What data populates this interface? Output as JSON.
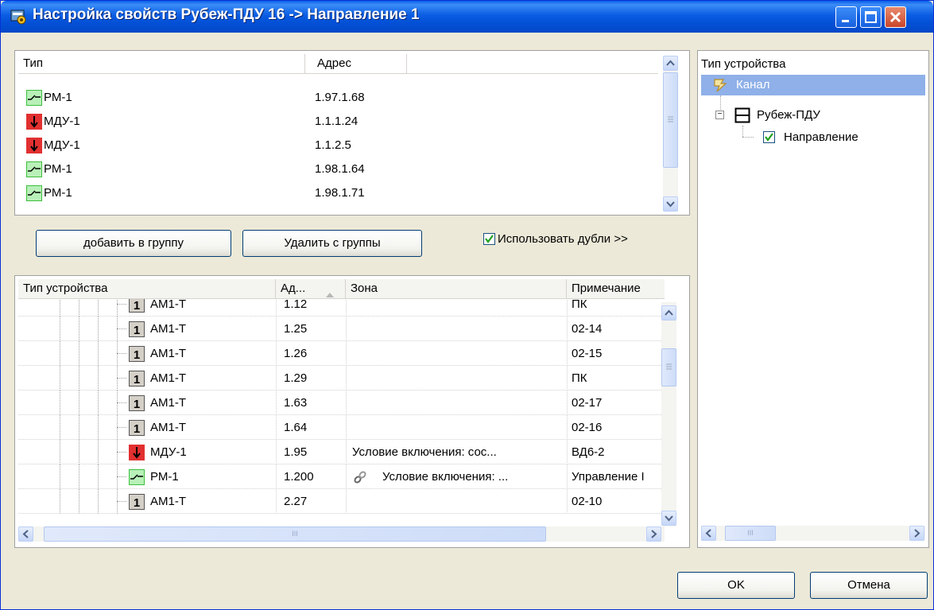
{
  "window": {
    "title": "Настройка свойств Рубеж-ПДУ 16 -> Направление 1"
  },
  "top_table": {
    "headers": {
      "type": "Тип",
      "address": "Адрес"
    },
    "rows": [
      {
        "icon": "relay-icon",
        "type": "РМ-1",
        "address": "1.97.1.68"
      },
      {
        "icon": "mdu-icon",
        "type": "МДУ-1",
        "address": "1.1.1.24"
      },
      {
        "icon": "mdu-icon",
        "type": "МДУ-1",
        "address": "1.1.2.5"
      },
      {
        "icon": "relay-icon",
        "type": "РМ-1",
        "address": "1.98.1.64"
      },
      {
        "icon": "relay-icon",
        "type": "РМ-1",
        "address": "1.98.1.71"
      }
    ]
  },
  "buttons": {
    "add": "добавить в группу",
    "remove": "Удалить с группы",
    "ok": "OK",
    "cancel": "Отмена"
  },
  "use_duplicates": {
    "label": "Использовать дубли >>",
    "checked": true
  },
  "bottom_table": {
    "headers": {
      "device_type": "Тип устройства",
      "address": "Ад...",
      "zone": "Зона",
      "note": "Примечание"
    },
    "rows": [
      {
        "icon": "am1-icon",
        "type": "АМ1-Т",
        "address": "1.12",
        "zone": "",
        "note": "ПК"
      },
      {
        "icon": "am1-icon",
        "type": "АМ1-Т",
        "address": "1.25",
        "zone": "",
        "note": "02-14"
      },
      {
        "icon": "am1-icon",
        "type": "АМ1-Т",
        "address": "1.26",
        "zone": "",
        "note": "02-15"
      },
      {
        "icon": "am1-icon",
        "type": "АМ1-Т",
        "address": "1.29",
        "zone": "",
        "note": "ПК"
      },
      {
        "icon": "am1-icon",
        "type": "АМ1-Т",
        "address": "1.63",
        "zone": "",
        "note": "02-17"
      },
      {
        "icon": "am1-icon",
        "type": "АМ1-Т",
        "address": "1.64",
        "zone": "",
        "note": "02-16"
      },
      {
        "icon": "mdu-icon",
        "type": "МДУ-1",
        "address": "1.95",
        "zone": "Условие включения: сос...",
        "note": "ВД6-2"
      },
      {
        "icon": "relay-icon",
        "type": "РМ-1",
        "address": "1.200",
        "zone": "Условие включения: ...",
        "note": "Управление I",
        "zone_icon": "link-icon"
      },
      {
        "icon": "am1-icon",
        "type": "АМ1-Т",
        "address": "2.27",
        "zone": "",
        "note": "02-10"
      }
    ]
  },
  "device_tree": {
    "header": "Тип устройства",
    "items": [
      {
        "label": "Канал",
        "selected": true,
        "icon": "channel-icon"
      },
      {
        "label": "Рубеж-ПДУ",
        "icon": "pdu-icon",
        "expander": "−"
      },
      {
        "label": "Направление",
        "icon": "checkbox-checked"
      }
    ]
  },
  "colors": {
    "accent": "#0a5fe8",
    "selection": "#8fb0e8",
    "relay_green": "#3cbf3c",
    "mdu_red": "#e23030"
  },
  "am1_glyph": "1",
  "scroll_grip": "III"
}
